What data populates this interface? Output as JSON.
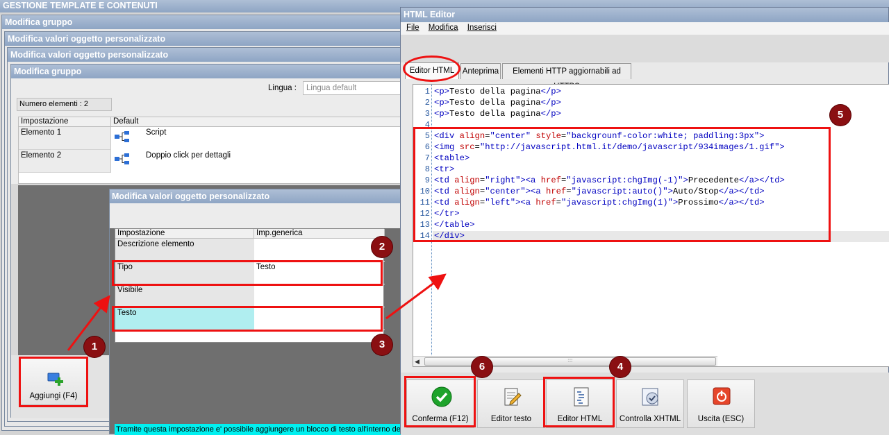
{
  "main_title": "GESTIONE TEMPLATE E CONTENUTI",
  "windows": {
    "w1": "Modifica gruppo",
    "w2": "Modifica valori oggetto personalizzato",
    "w3": "Modifica valori oggetto personalizzato",
    "w4": "Modifica gruppo"
  },
  "group": {
    "lingua_label": "Lingua :",
    "lingua_value": "Lingua default",
    "numero_elementi": "Numero elementi : 2",
    "headers": [
      "Impostazione",
      "Default"
    ],
    "rows": [
      {
        "name": "Elemento 1",
        "value": "Script"
      },
      {
        "name": "Elemento 2",
        "value": "Doppio click per dettagli"
      }
    ],
    "add_button": "Aggiungi (F4)"
  },
  "custom": {
    "title": "Modifica valori oggetto personalizzato",
    "headers": [
      "Impostazione",
      "Imp.generica"
    ],
    "rows": [
      {
        "name": "Descrizione elemento",
        "value": ""
      },
      {
        "name": "Tipo",
        "value": "Testo"
      },
      {
        "name": "Visibile",
        "value": ""
      },
      {
        "name": "Testo",
        "value": ""
      }
    ],
    "hint": "Tramite questa impostazione e' possibile aggiungere un blocco di testo all'interno della"
  },
  "editor": {
    "title": "HTML Editor",
    "menu": [
      "File",
      "Modifica",
      "Inserisci"
    ],
    "tabs": [
      "Editor HTML",
      "Anteprima",
      "Elementi HTTP aggiornabili ad HTTPS"
    ],
    "lines": [
      "<p>Testo della pagina</p>",
      "<p>Testo della pagina</p>",
      "<p>Testo della pagina</p>",
      "",
      "<div align=\"center\" style=\"backgrounf-color:white; paddling:3px\">",
      "<img src=\"http://javascript.html.it/demo/javascript/934images/1.gif\">",
      "<table>",
      "<tr>",
      "<td align=\"right\"><a href=\"javascript:chgImg(-1)\">Precedente</a></td>",
      "<td align=\"center\"><a href=\"javascript:auto()\">Auto/Stop</a></td>",
      "<td align=\"left\"><a href=\"javascript:chgImg(1)\">Prossimo</a></td>",
      "</tr>",
      "</table>",
      "</div>"
    ],
    "buttons": [
      "Conferma (F12)",
      "Editor testo",
      "Editor HTML",
      "Controlla XHTML",
      "Uscita (ESC)"
    ]
  },
  "badges": [
    "1",
    "2",
    "3",
    "4",
    "5",
    "6"
  ],
  "colors": {
    "highlight": "#e11111",
    "badge": "#8a0f12",
    "selected_row": "#b0eef0",
    "hint_bg": "#00f0f0"
  }
}
